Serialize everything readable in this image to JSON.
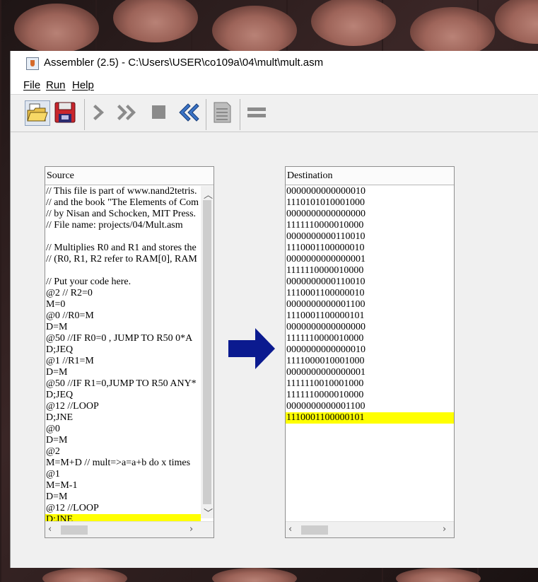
{
  "window": {
    "title": "Assembler (2.5) - C:\\Users\\USER\\co109a\\04\\mult\\mult.asm"
  },
  "menu": [
    "File",
    "Run",
    "Help"
  ],
  "toolbar": {
    "buttons": [
      "open-file-icon",
      "save-icon",
      "single-step-icon",
      "fast-forward-icon",
      "stop-icon",
      "rewind-icon",
      "compare-file-icon",
      "translation-format-icon"
    ]
  },
  "source": {
    "header": "Source",
    "lines": [
      "// This file is part of www.nand2tetris.",
      "// and the book \"The Elements of Com",
      "// by Nisan and Schocken, MIT Press.",
      "// File name: projects/04/Mult.asm",
      "",
      "// Multiplies R0 and R1 and stores the",
      "// (R0, R1, R2 refer to RAM[0], RAM",
      "",
      "// Put your code here.",
      "@2    // R2=0",
      "M=0",
      "@0   //R0=M",
      "D=M",
      "@50  //IF R0=0 , JUMP TO R50  0*A",
      "D;JEQ",
      "@1  //R1=M",
      "D=M",
      "@50 //IF R1=0,JUMP TO R50 ANY*",
      "D;JEQ",
      "@12 //LOOP",
      "D;JNE",
      "@0",
      "D=M",
      "@2",
      "M=M+D // mult=>a=a+b do x times",
      "@1",
      "M=M-1",
      "D=M",
      "@12 //LOOP",
      "D;JNE"
    ],
    "highlighted_line": 29
  },
  "destination": {
    "header": "Destination",
    "lines": [
      "0000000000000010",
      "1110101010001000",
      "0000000000000000",
      "1111110000010000",
      "0000000000110010",
      "1110001100000010",
      "0000000000000001",
      "1111110000010000",
      "0000000000110010",
      "1110001100000010",
      "0000000000001100",
      "1110001100000101",
      "0000000000000000",
      "1111110000010000",
      "0000000000000010",
      "1111000010001000",
      "0000000000000001",
      "1111110010001000",
      "1111110000010000",
      "0000000000001100",
      "1110001100000101"
    ],
    "highlighted_line": 20
  },
  "colors": {
    "highlight": "#ffff00",
    "arrow": "#0b1a8f"
  }
}
